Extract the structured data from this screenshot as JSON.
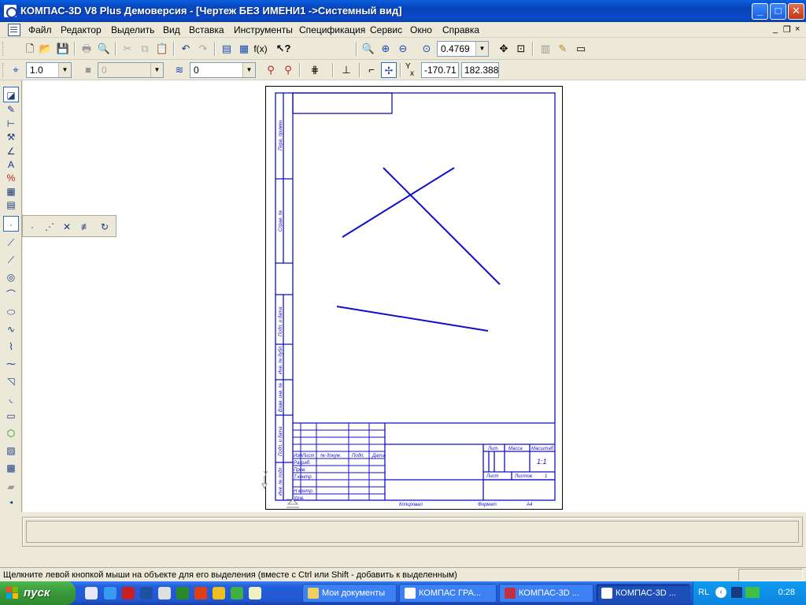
{
  "window": {
    "title": "КОМПАС-3D V8 Plus Демоверсия - [Чертеж БЕЗ ИМЕНИ1 ->Системный вид]",
    "buttons": {
      "minimize": "_",
      "maximize": "□",
      "close": "✕"
    }
  },
  "menu": {
    "items": [
      "Файл",
      "Редактор",
      "Выделить",
      "Вид",
      "Вставка",
      "Инструменты",
      "Спецификация",
      "Сервис",
      "Окно",
      "Справка"
    ],
    "mdi": {
      "minimize": "_",
      "restore": "❐",
      "close": "×"
    }
  },
  "toolbar1": {
    "icons": [
      "new-icon",
      "open-icon",
      "save-icon",
      "print-icon",
      "preview-icon",
      "cut-icon",
      "copy-icon",
      "paste-icon",
      "undo-icon",
      "redo-icon",
      "manager-icon",
      "library-icon",
      "fx-icon",
      "help-icon",
      "zoom-in-icon",
      "zoom-window-icon",
      "zoom-out-icon",
      "zoom-scale-icon",
      "pan-icon",
      "zoom-all-icon",
      "library-manager-icon",
      "brush-icon",
      "view-icon"
    ],
    "fx_label": "f(x)",
    "zoom_value": "0.4769"
  },
  "toolbar2": {
    "scale_value": "1.0",
    "layer_value": "0",
    "style_value": "0",
    "x_label": "Y",
    "x_sub": "x",
    "coord_x": "-170.71",
    "coord_y": "182.388"
  },
  "left_tools": [
    "select-icon",
    "geometry-icon",
    "dimensions-icon",
    "hammer-icon",
    "angle-icon",
    "text-icon",
    "measure-icon",
    "table-icon",
    "specification-icon",
    "point-icon",
    "auxline-icon",
    "segment-icon",
    "circle-icon",
    "arc-icon",
    "ellipse-icon",
    "spline-icon",
    "polyline-icon",
    "bezier-icon",
    "chamfer-icon",
    "fillet-icon",
    "rectangle-icon",
    "polygon-icon",
    "hatch-icon",
    "fill-icon",
    "erase-icon",
    "scroll-down-icon"
  ],
  "flyout_tools": [
    "point-icon",
    "points-on-curve-icon",
    "intersection-points-icon",
    "equal-points-icon",
    "arc-points-icon"
  ],
  "drawing": {
    "stamp_labels": {
      "perv_primen": "Перв. примен.",
      "sprav": "Справ. №",
      "podp_data_1": "Подп. и дата",
      "inv_dubl": "Инв. № дубл.",
      "vzam_inv": "Взам. инв. №",
      "podp_data_2": "Подп. и дата",
      "inv_podl": "Инв. № подл.",
      "izm": "Изм",
      "list": "Лист",
      "doc_no": "№ докум.",
      "podp": "Подп.",
      "data": "Дата",
      "razrab": "Разраб.",
      "prov": "Пров.",
      "tkontr": "Т.контр.",
      "nkontr": "Н.контр.",
      "utv": "Утв.",
      "lit": "Лит.",
      "massa": "Масса",
      "masshtab": "Масштаб",
      "scale_value": "1:1",
      "list2": "Лист",
      "listov": "Листов",
      "listov_value": "1",
      "kopiroval": "Копировал",
      "format": "Формат",
      "format_value": "А4"
    },
    "origin_label": "Y"
  },
  "status": {
    "hint": "Щелкните левой кнопкой мыши на объекте для его выделения (вместе с Ctrl или Shift - добавить к выделенным)"
  },
  "taskbar": {
    "start": "пуск",
    "tasks": [
      "Мои документы",
      "КОМПАС ГРА...",
      "КОМПАС-3D ...",
      "КОМПАС-3D ..."
    ],
    "lang": "RL",
    "clock": "0:28"
  }
}
